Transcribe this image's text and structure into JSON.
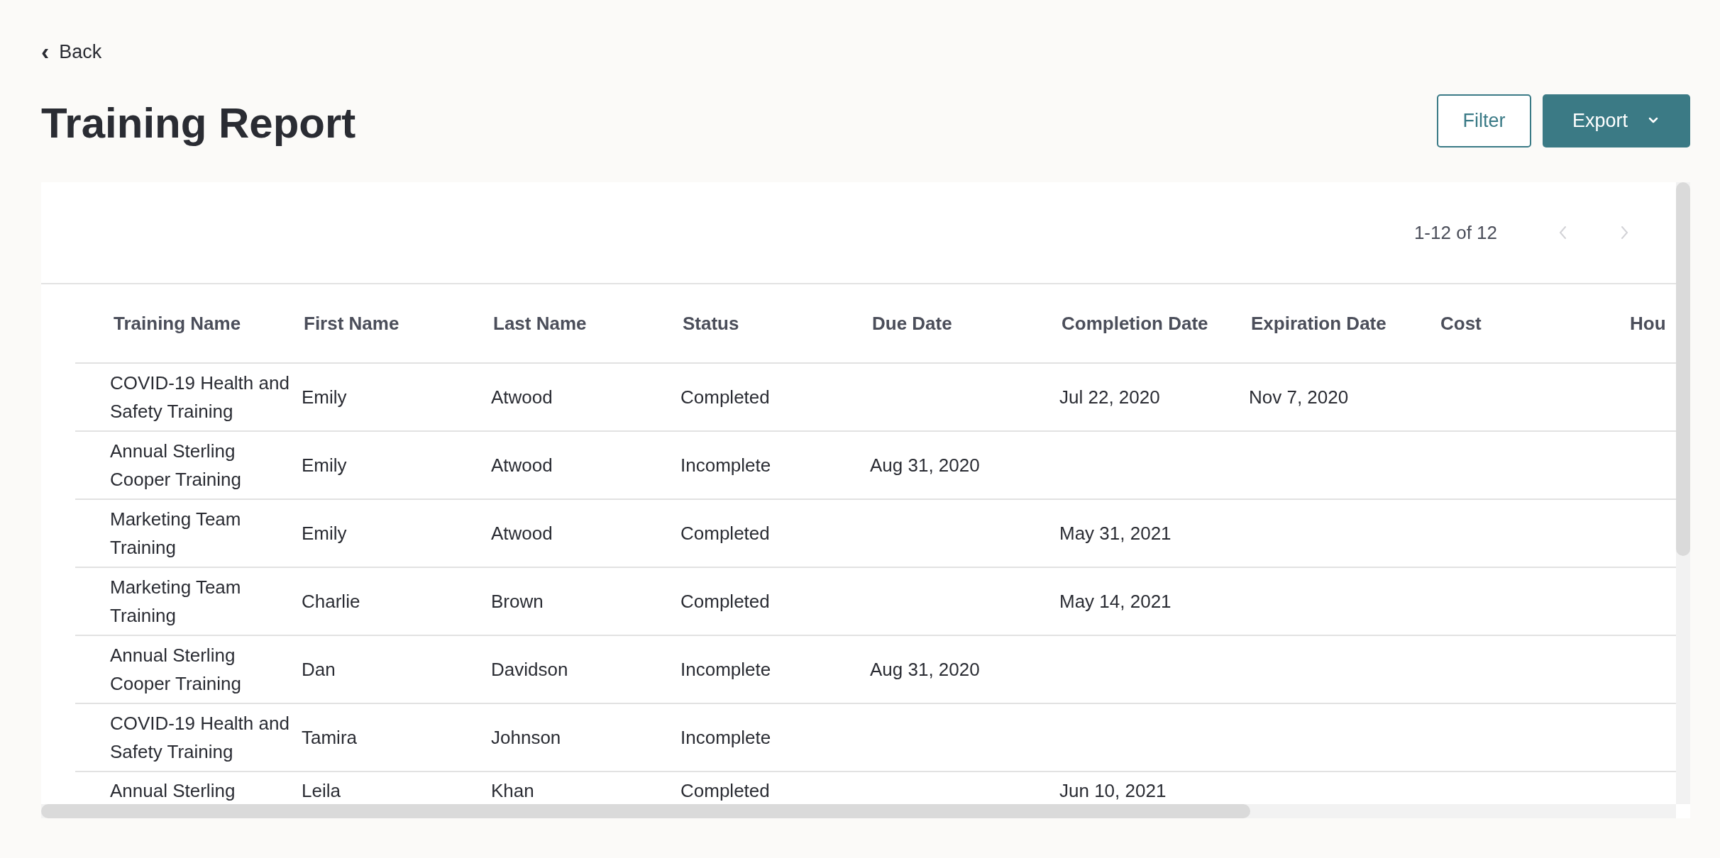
{
  "back_link": {
    "icon": "‹",
    "label": "Back"
  },
  "title": "Training Report",
  "actions": {
    "filter": "Filter",
    "export": "Export"
  },
  "pagination": {
    "range": "1-12 of 12",
    "prev_disabled": true,
    "next_disabled": true
  },
  "table": {
    "columns": [
      "Training Name",
      "First Name",
      "Last Name",
      "Status",
      "Due Date",
      "Completion Date",
      "Expiration Date",
      "Cost",
      "Hou"
    ],
    "rows": [
      {
        "cells": [
          "COVID-19 Health and Safety Training",
          "Emily",
          "Atwood",
          "Completed",
          "",
          "Jul 22, 2020",
          "Nov 7, 2020",
          "",
          ""
        ]
      },
      {
        "cells": [
          "Annual Sterling Cooper Training",
          "Emily",
          "Atwood",
          "Incomplete",
          "Aug 31, 2020",
          "",
          "",
          "",
          ""
        ]
      },
      {
        "cells": [
          "Marketing Team Training",
          "Emily",
          "Atwood",
          "Completed",
          "",
          "May 31, 2021",
          "",
          "",
          ""
        ]
      },
      {
        "cells": [
          "Marketing Team Training",
          "Charlie",
          "Brown",
          "Completed",
          "",
          "May 14, 2021",
          "",
          "",
          ""
        ]
      },
      {
        "cells": [
          "Annual Sterling Cooper Training",
          "Dan",
          "Davidson",
          "Incomplete",
          "Aug 31, 2020",
          "",
          "",
          "",
          ""
        ]
      },
      {
        "cells": [
          "COVID-19 Health and Safety Training",
          "Tamira",
          "Johnson",
          "Incomplete",
          "",
          "",
          "",
          "",
          ""
        ]
      },
      {
        "cells": [
          "Annual Sterling",
          "Leila",
          "Khan",
          "Completed",
          "",
          "Jun 10, 2021",
          "",
          "",
          ""
        ]
      }
    ]
  }
}
